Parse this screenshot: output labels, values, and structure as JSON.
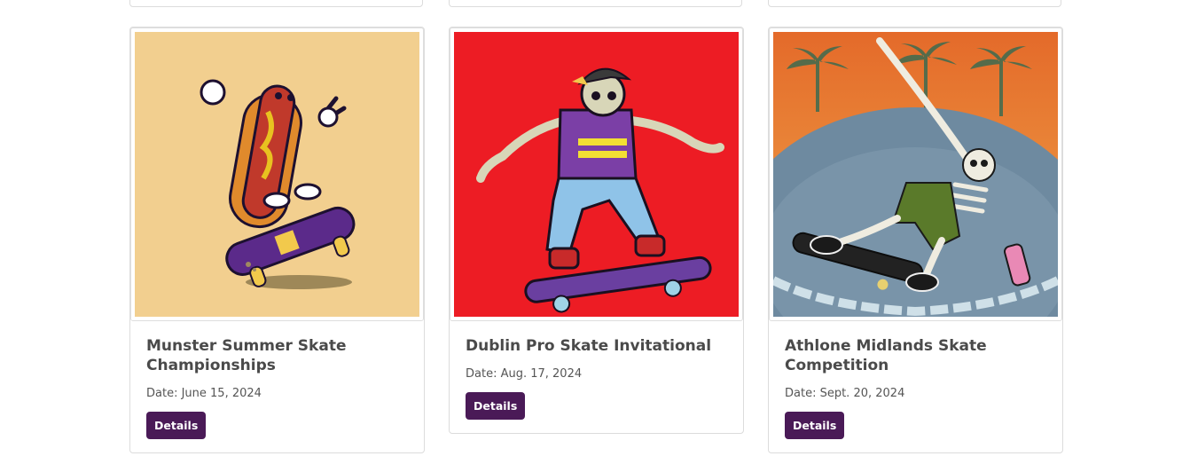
{
  "events": [
    {
      "title": "Munster Summer Skate Championships",
      "date": "Date: June 15, 2024",
      "button": "Details",
      "image_subject": "hot-dog-skateboarder-illustration",
      "bg_color": "#f2cf8f"
    },
    {
      "title": "Dublin Pro Skate Invitational",
      "date": "Date: Aug. 17, 2024",
      "button": "Details",
      "image_subject": "skeleton-skateboarder-illustration",
      "bg_color": "#ed1c24"
    },
    {
      "title": "Athlone Midlands Skate Competition",
      "date": "Date: Sept. 20, 2024",
      "button": "Details",
      "image_subject": "skeleton-pool-skater-painting",
      "bg_color": "#e98a3a"
    }
  ],
  "colors": {
    "button_bg": "#4a1a57",
    "title_text": "#4a4a4a"
  }
}
